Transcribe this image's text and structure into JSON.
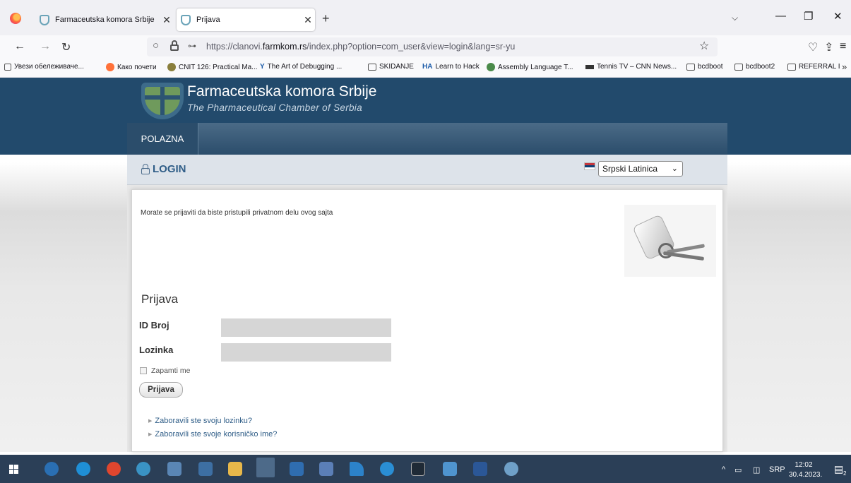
{
  "browser": {
    "tabs": [
      {
        "label": "Farmaceutska komora Srbije"
      },
      {
        "label": "Prijava"
      }
    ],
    "url_prefix": "https://clanovi.",
    "url_domain": "farmkom.rs",
    "url_rest": "/index.php?option=com_user&view=login&lang=sr-yu",
    "bookmarks": [
      "Увези обележиваче...",
      "Како почети",
      "CNIT 126: Practical Ma...",
      "The Art of Debugging ...",
      "SKIDANJE",
      "Learn to Hack",
      "Assembly Language T...",
      "Tennis TV – CNN News...",
      "bcdboot",
      "bcdboot2",
      "REFERRAL I"
    ],
    "bookmark_glyphs": {
      "y": "Y",
      "ha": "HA"
    }
  },
  "site": {
    "title": "Farmaceutska komora Srbije",
    "subtitle": "The Pharmaceutical Chamber of Serbia",
    "menu": [
      "POLAZNA"
    ],
    "login_title": "LOGIN",
    "language_selected": "Srpski Latinica",
    "notice": "Morate se prijaviti da biste pristupili privatnom delu ovog sajta",
    "form": {
      "heading": "Prijava",
      "id_label": "ID Broj",
      "password_label": "Lozinka",
      "remember_label": "Zapamti me",
      "submit_label": "Prijava",
      "forgot_password": "Zaboravili ste svoju lozinku?",
      "forgot_username": "Zaboravili ste svoje korisničko ime?"
    }
  },
  "taskbar": {
    "tray_lang": "SRP",
    "time": "12:02",
    "date": "30.4.2023.",
    "notifications": "2"
  },
  "colors": {
    "header": "#224a6c",
    "link": "#2f5d87",
    "taskbar": "#2b3f57"
  }
}
